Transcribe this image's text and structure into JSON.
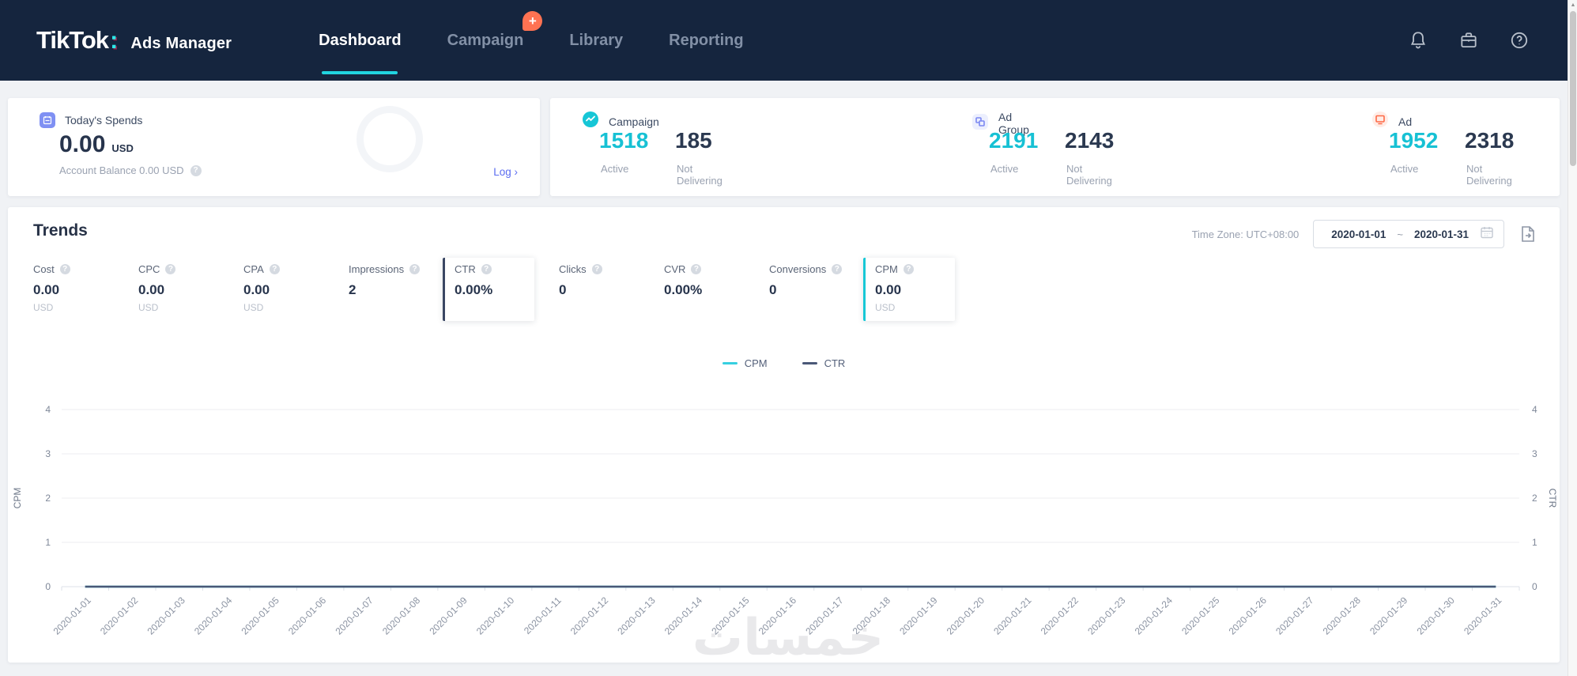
{
  "header": {
    "logo": {
      "brand": "TikTok",
      "colon": ":",
      "suffix": "Ads Manager"
    },
    "nav": [
      {
        "label": "Dashboard",
        "active": true
      },
      {
        "label": "Campaign",
        "active": false,
        "badge": "+"
      },
      {
        "label": "Library",
        "active": false
      },
      {
        "label": "Reporting",
        "active": false
      }
    ],
    "icons": [
      "bell-icon",
      "briefcase-icon",
      "help-icon"
    ]
  },
  "spends": {
    "title": "Today's Spends",
    "amount": "0.00",
    "currency": "USD",
    "balance": "Account Balance 0.00 USD",
    "log": "Log",
    "log_arrow": "›"
  },
  "entity_stats": [
    {
      "name": "Campaign",
      "icon": "campaign-icon",
      "active": "1518",
      "active_label": "Active",
      "not_delivering": "185",
      "not_delivering_label": "Not Delivering"
    },
    {
      "name": "Ad Group",
      "icon": "ad-group-icon",
      "active": "2191",
      "active_label": "Active",
      "not_delivering": "2143",
      "not_delivering_label": "Not Delivering"
    },
    {
      "name": "Ad",
      "icon": "ad-icon",
      "active": "1952",
      "active_label": "Active",
      "not_delivering": "2318",
      "not_delivering_label": "Not Delivering"
    }
  ],
  "trends": {
    "title": "Trends",
    "timezone": "Time Zone: UTC+08:00",
    "date_start": "2020-01-01",
    "date_sep": "~",
    "date_end": "2020-01-31",
    "metrics": [
      {
        "label": "Cost",
        "value": "0.00",
        "unit": "USD",
        "selected": false
      },
      {
        "label": "CPC",
        "value": "0.00",
        "unit": "USD",
        "selected": false
      },
      {
        "label": "CPA",
        "value": "0.00",
        "unit": "USD",
        "selected": false
      },
      {
        "label": "Impressions",
        "value": "2",
        "unit": "",
        "selected": false
      },
      {
        "label": "CTR",
        "value": "0.00%",
        "unit": "",
        "selected": true,
        "accent": "#3a4663"
      },
      {
        "label": "Clicks",
        "value": "0",
        "unit": "",
        "selected": false
      },
      {
        "label": "CVR",
        "value": "0.00%",
        "unit": "",
        "selected": false
      },
      {
        "label": "Conversions",
        "value": "0",
        "unit": "",
        "selected": false
      },
      {
        "label": "CPM",
        "value": "0.00",
        "unit": "USD",
        "selected": true,
        "accent": "#17c8d6"
      }
    ]
  },
  "chart_data": {
    "type": "line",
    "x": [
      "2020-01-01",
      "2020-01-02",
      "2020-01-03",
      "2020-01-04",
      "2020-01-05",
      "2020-01-06",
      "2020-01-07",
      "2020-01-08",
      "2020-01-09",
      "2020-01-10",
      "2020-01-11",
      "2020-01-12",
      "2020-01-13",
      "2020-01-14",
      "2020-01-15",
      "2020-01-16",
      "2020-01-17",
      "2020-01-18",
      "2020-01-19",
      "2020-01-20",
      "2020-01-21",
      "2020-01-22",
      "2020-01-23",
      "2020-01-24",
      "2020-01-25",
      "2020-01-26",
      "2020-01-27",
      "2020-01-28",
      "2020-01-29",
      "2020-01-30",
      "2020-01-31"
    ],
    "series": [
      {
        "name": "CPM",
        "color": "#36cfe0",
        "values": [
          0,
          0,
          0,
          0,
          0,
          0,
          0,
          0,
          0,
          0,
          0,
          0,
          0,
          0,
          0,
          0,
          0,
          0,
          0,
          0,
          0,
          0,
          0,
          0,
          0,
          0,
          0,
          0,
          0,
          0,
          0
        ]
      },
      {
        "name": "CTR",
        "color": "#4a5877",
        "values": [
          0,
          0,
          0,
          0,
          0,
          0,
          0,
          0,
          0,
          0,
          0,
          0,
          0,
          0,
          0,
          0,
          0,
          0,
          0,
          0,
          0,
          0,
          0,
          0,
          0,
          0,
          0,
          0,
          0,
          0,
          0
        ]
      }
    ],
    "ylabel_left": "CPM",
    "ylabel_right": "CTR",
    "yticks": [
      0,
      1,
      2,
      3,
      4
    ],
    "ylim": [
      0,
      4
    ],
    "grid": true,
    "legend_position": "top-center"
  },
  "watermark": {
    "text": "خمسات"
  },
  "colors": {
    "accent_cyan": "#17c1d4",
    "dark": "#2b3950",
    "coral": "#fe7252"
  }
}
